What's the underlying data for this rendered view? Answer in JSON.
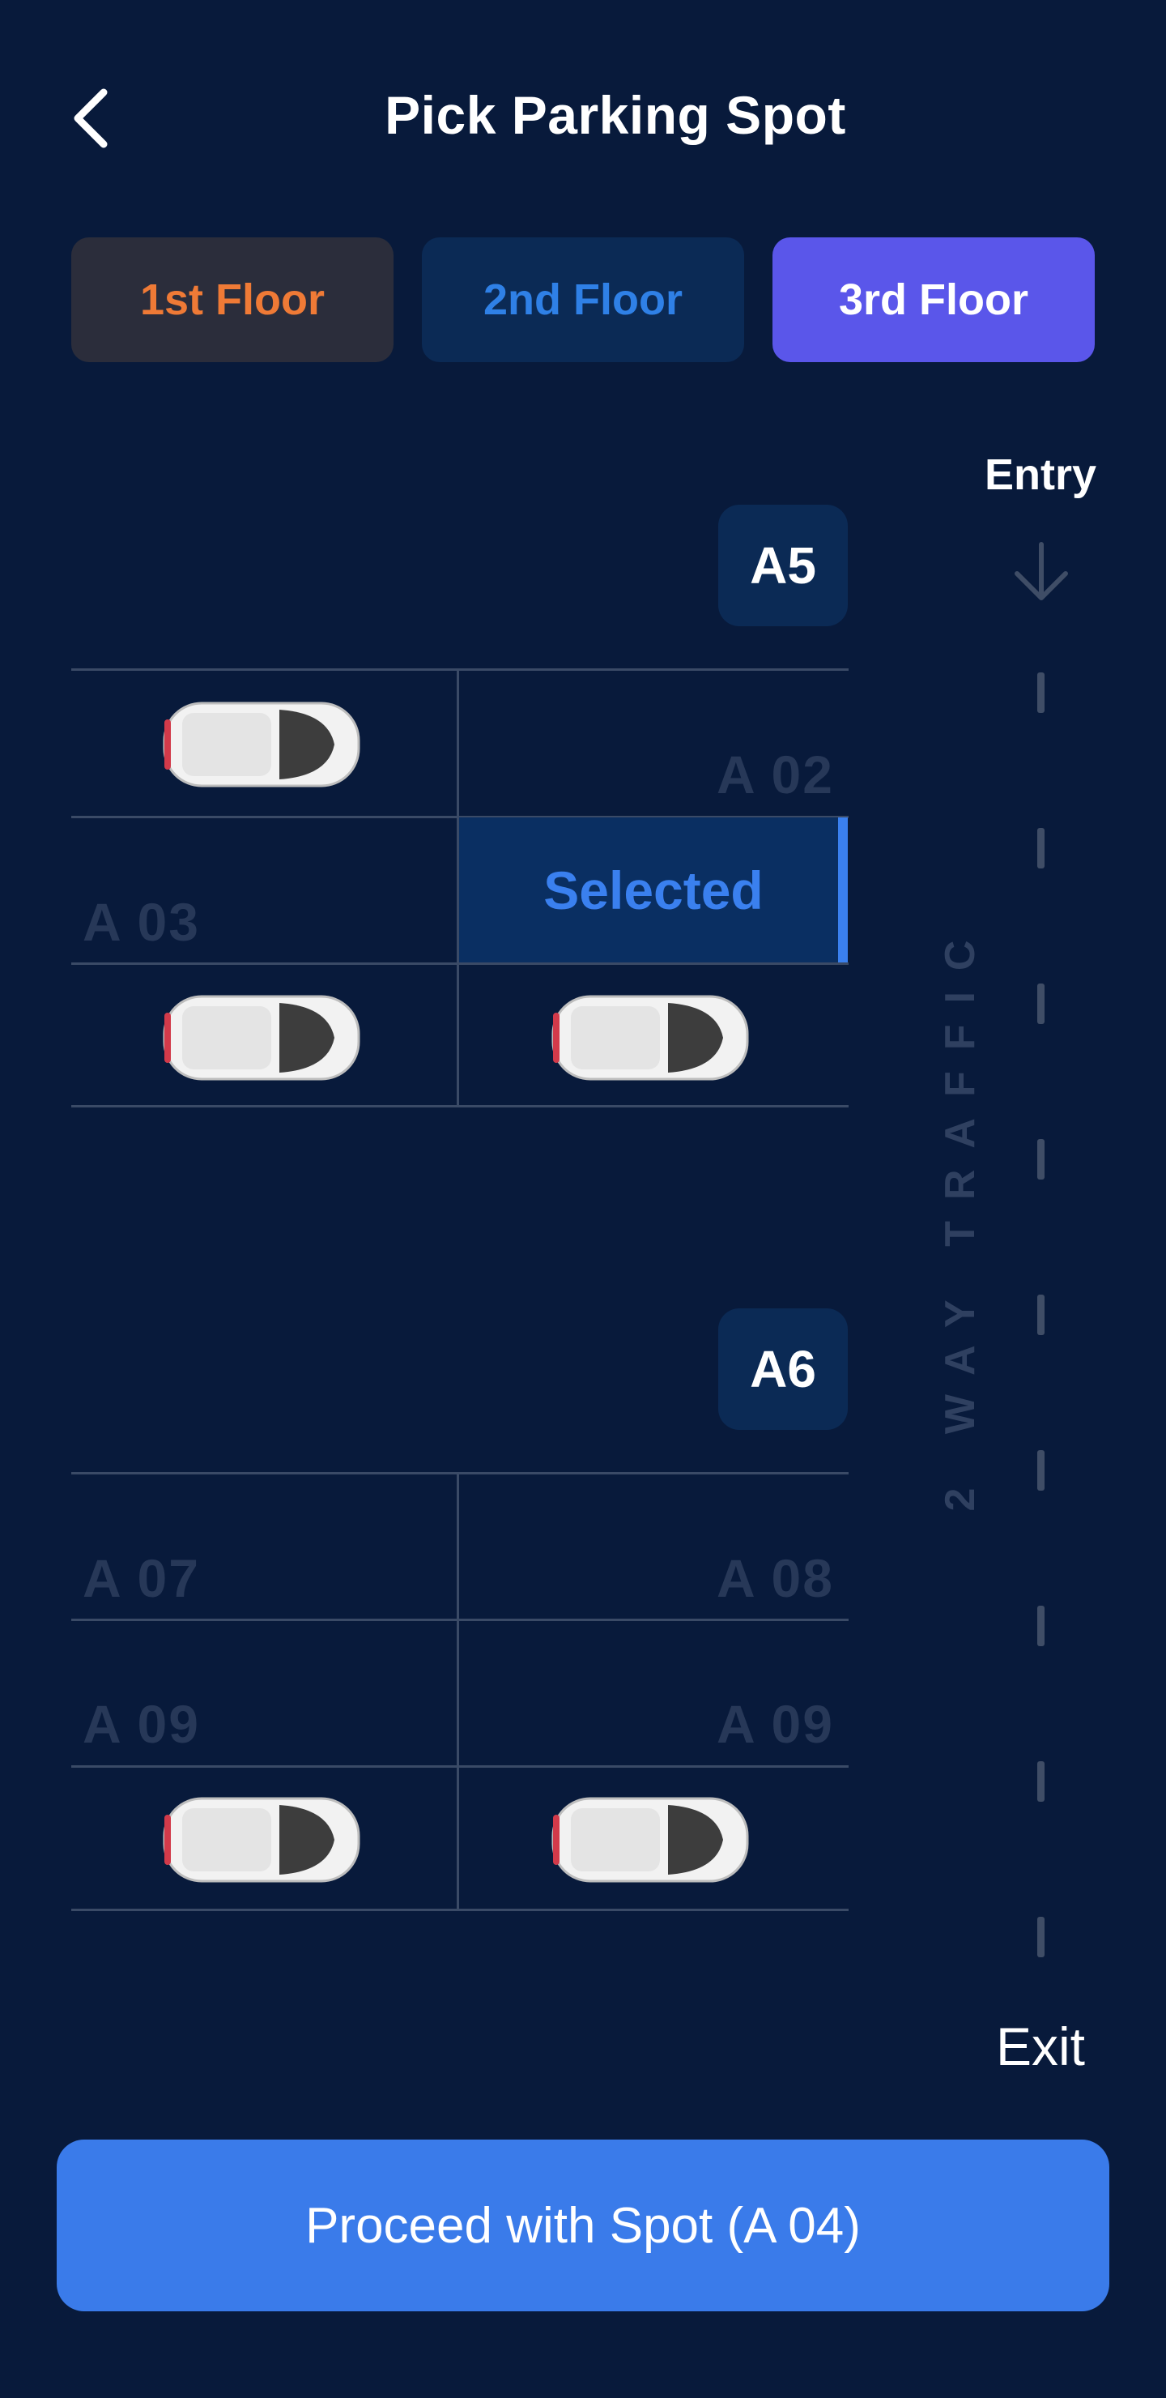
{
  "header": {
    "title": "Pick Parking Spot",
    "back_icon": "chevron-left-icon"
  },
  "floors": [
    {
      "label": "1st Floor",
      "color": "#ef7a36",
      "background": "#2b2d3b"
    },
    {
      "label": "2nd Floor",
      "color": "#2f80e6",
      "background": "#0b2a55"
    },
    {
      "label": "3rd Floor",
      "color": "#ffffff",
      "background": "#5a56ea",
      "active": true
    }
  ],
  "sections": [
    {
      "badge": "A5",
      "spots": [
        {
          "label": "",
          "occupied": true
        },
        {
          "label": "A 02",
          "occupied": false
        },
        {
          "label": "A 03",
          "occupied": false
        },
        {
          "label": "Selected",
          "occupied": false,
          "selected": true
        },
        {
          "label": "",
          "occupied": true
        },
        {
          "label": "",
          "occupied": true
        }
      ]
    },
    {
      "badge": "A6",
      "spots": [
        {
          "label": "A 07",
          "occupied": false
        },
        {
          "label": "A 08",
          "occupied": false
        },
        {
          "label": "A 09",
          "occupied": false
        },
        {
          "label": "A 09",
          "occupied": false
        },
        {
          "label": "",
          "occupied": true
        },
        {
          "label": "",
          "occupied": true
        }
      ]
    }
  ],
  "lane": {
    "entry": "Entry",
    "exit": "Exit",
    "traffic": "2 WAY TRAFFIC",
    "arrow_icon": "arrow-down-icon"
  },
  "proceed_button": "Proceed with Spot (A 04)",
  "colors": {
    "background": "#081a3b",
    "accent": "#3a7bea",
    "selected": "#3a80ef"
  }
}
